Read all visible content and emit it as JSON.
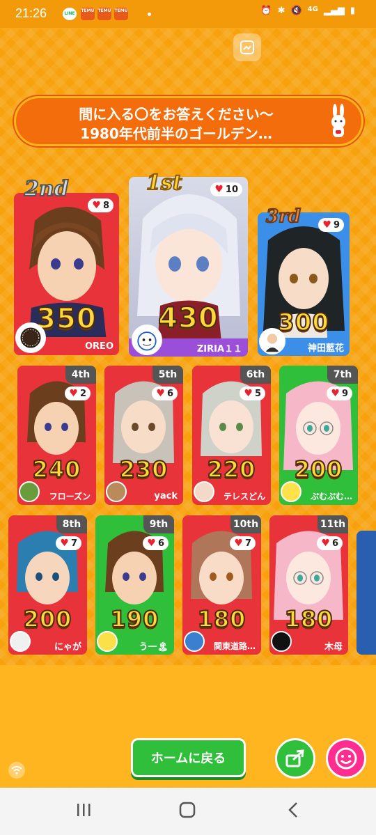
{
  "status_bar": {
    "time": "21:26",
    "notifications": [
      "LINE",
      "TEMU",
      "TEMU",
      "TEMU"
    ],
    "network": "4G"
  },
  "question": {
    "line1": "間に入る〇をお答えください～",
    "line2": "1980年代前半のゴールデン…"
  },
  "podium": [
    {
      "rank": "1st",
      "score": "430",
      "likes": "10",
      "name": "ZIRIA１１",
      "color": "#9b4fd9"
    },
    {
      "rank": "2nd",
      "score": "350",
      "likes": "8",
      "name": "OREO",
      "color": "#e8333b"
    },
    {
      "rank": "3rd",
      "score": "300",
      "likes": "9",
      "name": "神田藍花",
      "color": "#3b8fe8"
    }
  ],
  "ranks": [
    {
      "rank": "4th",
      "score": "240",
      "likes": "2",
      "name": "フローズン",
      "color": "#e8333b"
    },
    {
      "rank": "5th",
      "score": "230",
      "likes": "6",
      "name": "yack",
      "color": "#e8333b"
    },
    {
      "rank": "6th",
      "score": "220",
      "likes": "5",
      "name": "テレスどん",
      "color": "#e8333b"
    },
    {
      "rank": "7th",
      "score": "200",
      "likes": "9",
      "name": "ぷむぷむ…",
      "color": "#2fbf3a"
    },
    {
      "rank": "8th",
      "score": "200",
      "likes": "7",
      "name": "にゃが",
      "color": "#e8333b"
    },
    {
      "rank": "9th",
      "score": "190",
      "likes": "6",
      "name": "う一🏝",
      "color": "#2fbf3a"
    },
    {
      "rank": "10th",
      "score": "180",
      "likes": "7",
      "name": "関東道路…",
      "color": "#e8333b"
    },
    {
      "rank": "11th",
      "score": "180",
      "likes": "6",
      "name": "木母",
      "color": "#e8333b"
    }
  ],
  "buttons": {
    "home": "ホームに戻る"
  }
}
